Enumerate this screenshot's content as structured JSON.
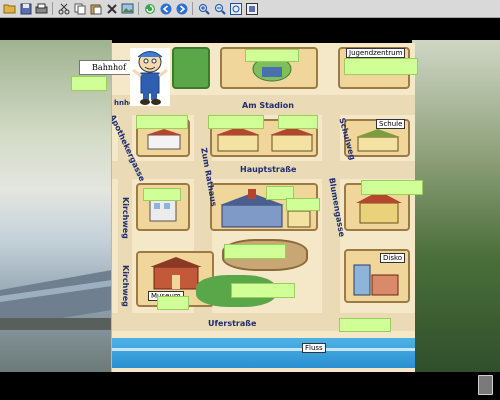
{
  "toolbar": {
    "icons": [
      "folder-icon",
      "save-icon",
      "print-icon",
      "cut-icon",
      "copy-icon",
      "paste-icon",
      "delete-icon",
      "image-icon",
      "refresh-icon",
      "back-icon",
      "forward-icon",
      "zoom-in-icon",
      "zoom-out-icon",
      "zoom-fit-icon",
      "fullscreen-icon"
    ]
  },
  "drag_label": "Bahnhof",
  "map": {
    "streets": {
      "am_stadion": "Am Stadion",
      "hauptstrasse": "Hauptstraße",
      "uferstrasse": "Uferstraße",
      "apothekergasse": "Apothekergasse",
      "zum_rathaus": "Zum Rathaus",
      "schulweg": "Schulweg",
      "blumengasse": "Blumengasse",
      "kirchweg_top": "Kirchweg",
      "kirchweg_bottom": "Kirchweg",
      "bahnhof_partial": "hnhe"
    },
    "signs": {
      "jugendzentrum": "Jugendzentrum",
      "schule": "Schule",
      "disko": "Disko",
      "museum": "Museum",
      "fluss": "Fluss"
    }
  },
  "colors": {
    "zone_fill": "#cfff96",
    "map_bg": "#f5e8c8",
    "street_text": "#1f2d6f",
    "river": "#2a8fd0"
  }
}
